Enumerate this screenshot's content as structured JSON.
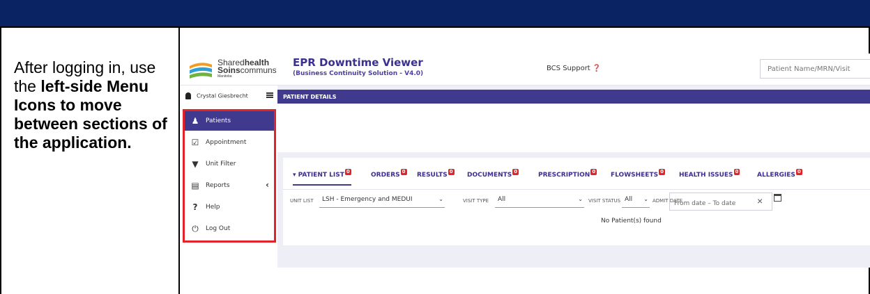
{
  "instructions": {
    "part1": "After logging in, use the ",
    "part2": "left-side Menu Icons to move between sections of the application."
  },
  "app": {
    "logo": {
      "line1a": "Shared",
      "line1b": "health",
      "line2a": "Soins",
      "line2b": "communs",
      "line3": "Manitoba"
    },
    "title": "EPR Downtime Viewer",
    "subtitle": "(Business Continuity Solution - V4.0)",
    "support": "BCS Support ❓",
    "search_placeholder": "Patient Name/MRN/Visit"
  },
  "sidebar": {
    "user": "Crystal Giesbrecht",
    "items": [
      {
        "label": "Patients",
        "icon": "patients-icon"
      },
      {
        "label": "Appointment",
        "icon": "calendar-icon"
      },
      {
        "label": "Unit Filter",
        "icon": "filter-icon"
      },
      {
        "label": "Reports",
        "icon": "reports-icon"
      },
      {
        "label": "Help",
        "icon": "help-icon"
      },
      {
        "label": "Log Out",
        "icon": "power-icon"
      }
    ]
  },
  "main": {
    "patient_details": "PATIENT DETAILS",
    "tabs": [
      {
        "label": "PATIENT LIST",
        "count": "0"
      },
      {
        "label": "ORDERS",
        "count": "0"
      },
      {
        "label": "RESULTS",
        "count": "0"
      },
      {
        "label": "DOCUMENTS",
        "count": "0"
      },
      {
        "label": "PRESCRIPTION",
        "count": "0"
      },
      {
        "label": "FLOWSHEETS",
        "count": "0"
      },
      {
        "label": "HEALTH ISSUES",
        "count": "0"
      },
      {
        "label": "ALLERGIES",
        "count": "0"
      }
    ],
    "filters": {
      "unit_list_label": "UNIT LIST",
      "unit_list_value": "LSH - Emergency and MEDUI",
      "visit_type_label": "VISIT TYPE",
      "visit_type_value": "All",
      "visit_status_label": "VISIT STATUS",
      "visit_status_value": "All",
      "admit_date_label": "ADMIT DATE",
      "date_placeholder": "From date – To date"
    },
    "empty_message": "No Patient(s) found"
  },
  "colors": {
    "header_navy": "#0a2463",
    "app_purple": "#3f3a8e",
    "highlight_red": "#e0242a"
  }
}
